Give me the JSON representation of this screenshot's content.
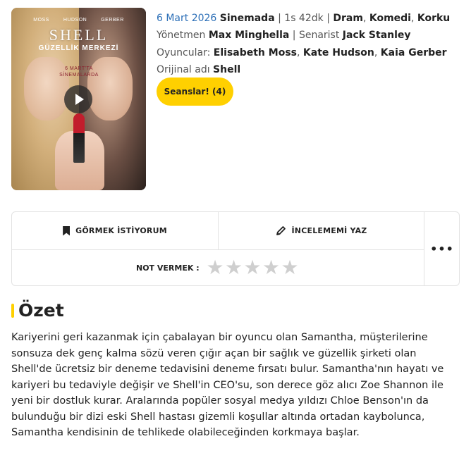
{
  "poster": {
    "credits": [
      "MOSS",
      "HUDSON",
      "GERBER"
    ],
    "title": "SHELL",
    "subtitle": "GÜZELLİK MERKEZİ",
    "release_line1": "6 MART'TA",
    "release_line2": "SİNEMALARDA"
  },
  "meta": {
    "date": "6 Mart 2026",
    "status": "Sinemada",
    "duration": "1s 42dk",
    "genres": [
      "Dram",
      "Komedi",
      "Korku"
    ],
    "director_label": "Yönetmen",
    "director": "Max Minghella",
    "writer_label": "Senarist",
    "writer": "Jack Stanley",
    "cast_label": "Oyuncular:",
    "cast": [
      "Elisabeth Moss",
      "Kate Hudson",
      "Kaia Gerber"
    ],
    "original_title_label": "Orijinal adı",
    "original_title": "Shell"
  },
  "sessions_button": "Seanslar! (4)",
  "actions": {
    "watchlist_label": "GÖRMEK İSTİYORUM",
    "review_label": "İNCELEMEMİ YAZ",
    "rate_label": "NOT VERMEK :",
    "rating_stars": 5,
    "rating_value": 0,
    "more_label": "•••"
  },
  "summary": {
    "heading": "Özet",
    "text": "Kariyerini geri kazanmak için çabalayan bir oyuncu olan Samantha, müşterilerine sonsuza dek genç kalma sözü veren çığır açan bir sağlık ve güzellik şirketi olan Shell'de ücretsiz bir deneme tedavisini deneme fırsatı bulur. Samantha'nın hayatı ve kariyeri bu tedaviyle değişir ve Shell'in CEO'su, son derece göz alıcı Zoe Shannon ile yeni bir dostluk kurar. Aralarında popüler sosyal medya yıldızı Chloe Benson'ın da bulunduğu bir dizi eski Shell hastası gizemli koşullar altında ortadan kaybolunca, Samantha kendisinin de tehlikede olabileceğinden korkmaya başlar."
  },
  "colors": {
    "accent": "#ffd000",
    "date_blue": "#2c6fb7",
    "star_empty": "#cfcfcf"
  }
}
